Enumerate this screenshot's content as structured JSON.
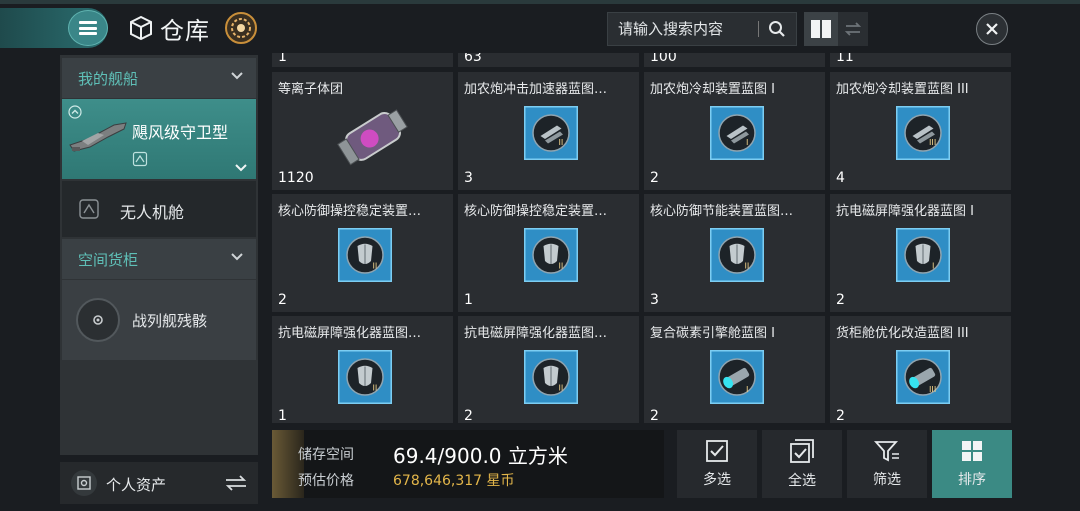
{
  "header": {
    "title": "仓库",
    "search_placeholder": "请输入搜索内容"
  },
  "sidebar": {
    "my_ships_label": "我的舰船",
    "selected_ship": "飓风级守卫型",
    "drone_bay": "无人机舱",
    "space_cargo_label": "空间货柜",
    "wreck_item": "战列舰残骸",
    "personal_assets": "个人资产"
  },
  "grid": {
    "partial_row_quantities": [
      "1",
      "63",
      "100",
      "11"
    ],
    "items": [
      {
        "name": "等离子体团",
        "qty": "1120",
        "icon": "plasma-canister-icon"
      },
      {
        "name": "加农炮冲击加速器蓝图…",
        "qty": "3",
        "icon": "cannon-blueprint-icon",
        "tier": "II"
      },
      {
        "name": "加农炮冷却装置蓝图 I",
        "qty": "2",
        "icon": "cannon-blueprint-icon",
        "tier": "I"
      },
      {
        "name": "加农炮冷却装置蓝图 III",
        "qty": "4",
        "icon": "cannon-blueprint-icon",
        "tier": "III"
      },
      {
        "name": "核心防御操控稳定装置…",
        "qty": "2",
        "icon": "shield-blueprint-icon",
        "tier": "II"
      },
      {
        "name": "核心防御操控稳定装置…",
        "qty": "1",
        "icon": "shield-blueprint-icon",
        "tier": "II"
      },
      {
        "name": "核心防御节能装置蓝图…",
        "qty": "3",
        "icon": "shield-blueprint-icon",
        "tier": "II"
      },
      {
        "name": "抗电磁屏障强化器蓝图 I",
        "qty": "2",
        "icon": "shield-blueprint-icon",
        "tier": "I"
      },
      {
        "name": "抗电磁屏障强化器蓝图…",
        "qty": "1",
        "icon": "shield-blueprint-icon",
        "tier": "II"
      },
      {
        "name": "抗电磁屏障强化器蓝图…",
        "qty": "2",
        "icon": "shield-blueprint-icon",
        "tier": "II"
      },
      {
        "name": "复合碳素引擎舱蓝图 I",
        "qty": "2",
        "icon": "engine-blueprint-icon",
        "tier": "I"
      },
      {
        "name": "货柜舱优化改造蓝图 III",
        "qty": "2",
        "icon": "engine-blueprint-icon",
        "tier": "III"
      }
    ]
  },
  "footer": {
    "storage_label": "储存空间",
    "storage_value": "69.4/900.0 立方米",
    "price_label": "预估价格",
    "price_value": "678,646,317 星币",
    "btn_multi_select": "多选",
    "btn_select_all": "全选",
    "btn_filter": "筛选",
    "btn_sort": "排序"
  },
  "colors": {
    "accent_teal": "#3b8a84",
    "teal_text": "#5fc0b8",
    "gold_price": "#e3b64a"
  }
}
